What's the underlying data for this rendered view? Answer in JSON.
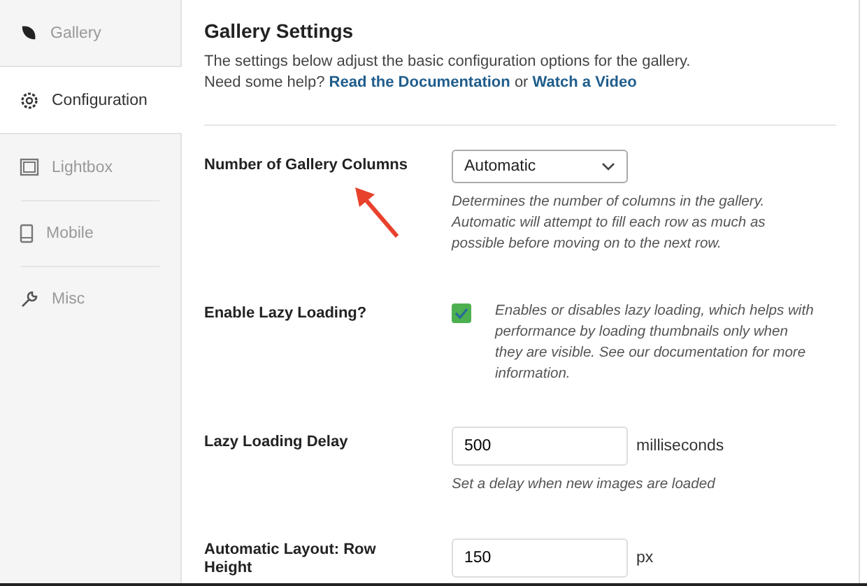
{
  "sidebar": {
    "items": [
      {
        "label": "Gallery",
        "selected": false
      },
      {
        "label": "Configuration",
        "selected": true
      },
      {
        "label": "Lightbox",
        "selected": false
      },
      {
        "label": "Mobile",
        "selected": false
      },
      {
        "label": "Misc",
        "selected": false
      }
    ]
  },
  "header": {
    "title": "Gallery Settings",
    "description": "The settings below adjust the basic configuration options for the gallery.",
    "help_prefix": "Need some help?",
    "link_1": "Read the Documentation",
    "joiner": "or",
    "link_2": "Watch a Video"
  },
  "settings": [
    {
      "kind": "select",
      "label": "Number of Gallery Columns",
      "value": "Automatic",
      "help": "Determines the number of columns in the gallery. Automatic will attempt to fill each row as much as possible before moving on to the next row."
    },
    {
      "kind": "checkbox",
      "label": "Enable Lazy Loading?",
      "checked": true,
      "help": "Enables or disables lazy loading, which helps with performance by loading thumbnails only when they are visible. See our documentation for more information."
    },
    {
      "kind": "number",
      "label": "Lazy Loading Delay",
      "value": "500",
      "unit": "milliseconds",
      "help": "Set a delay when new images are loaded"
    },
    {
      "kind": "number",
      "label": "Automatic Layout: Row Height",
      "value": "150",
      "unit": "px"
    }
  ]
}
